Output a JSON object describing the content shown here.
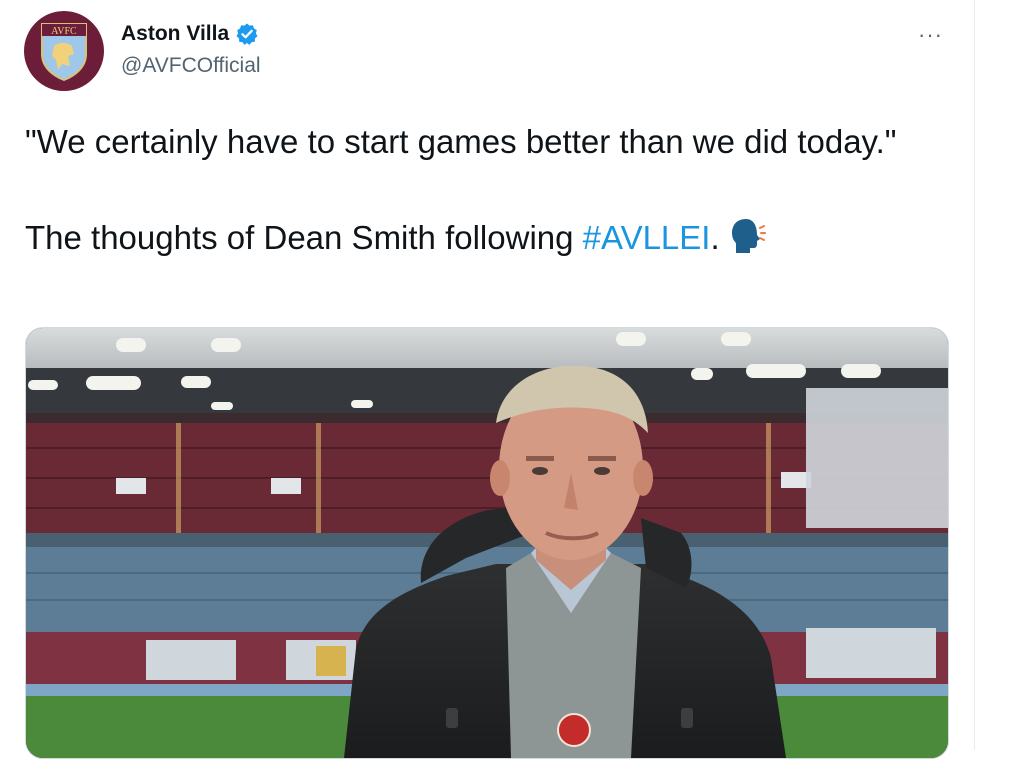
{
  "account": {
    "name": "Aston Villa",
    "handle": "@AVFCOfficial",
    "crest_text": "AVFC",
    "avatar_color": "#6b1d3a",
    "verified_color": "#1d9bf0"
  },
  "menu": {
    "more_label": "···"
  },
  "tweet": {
    "quote": "\"We certainly have to start games better than we did today.\"",
    "line2_prefix": "The thoughts of Dean Smith following ",
    "hashtag": "#AVLLEI",
    "line2_suffix": ".",
    "emoji": "speaking-head-icon",
    "hashtag_color": "#1b95e0"
  },
  "media": {
    "type": "video-thumbnail",
    "description_icon": "stadium-interview-scene"
  }
}
